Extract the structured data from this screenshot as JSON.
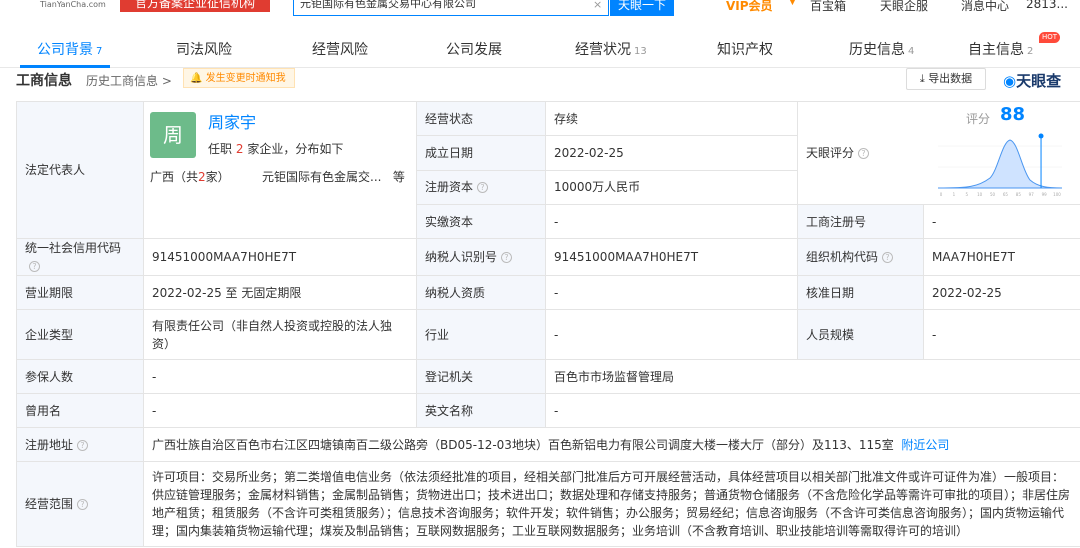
{
  "topbar": {
    "logo_text": "TianYanCha.com",
    "badge": "官方备案企业征信机构",
    "search_value": "元钜国际有色金属交易中心有限公司",
    "search_button": "天眼一下",
    "vip": "VIP会员",
    "links": [
      "百宝箱",
      "天眼企服",
      "消息中心",
      "2813..."
    ]
  },
  "tabs": [
    {
      "label": "公司背景",
      "count": "7"
    },
    {
      "label": "司法风险",
      "count": ""
    },
    {
      "label": "经营风险",
      "count": ""
    },
    {
      "label": "公司发展",
      "count": ""
    },
    {
      "label": "经营状况",
      "count": "13"
    },
    {
      "label": "知识产权",
      "count": ""
    },
    {
      "label": "历史信息",
      "count": "4"
    },
    {
      "label": "自主信息",
      "count": "2"
    }
  ],
  "hot_badge": "HOT",
  "section": {
    "title": "工商信息",
    "history_link": "历史工商信息 >",
    "notice": "发生变更时通知我",
    "export": "导出数据",
    "brand": "天眼查"
  },
  "legal_rep": {
    "label": "法定代表人",
    "avatar_char": "周",
    "name": "周家宇",
    "job_prefix": "任职",
    "job_count": "2",
    "job_suffix": "家企业，分布如下",
    "region_prefix": "广西（共",
    "region_count": "2",
    "region_suffix": "家）",
    "company": "元钜国际有色金属交...",
    "etc": "等"
  },
  "rows": {
    "status_label": "经营状态",
    "status": "存续",
    "founded_label": "成立日期",
    "founded": "2022-02-25",
    "capital_label": "注册资本",
    "capital": "10000万人民币",
    "paidin_label": "实缴资本",
    "paidin": "-",
    "score_label": "天眼评分",
    "regno_label": "工商注册号",
    "regno": "-",
    "credit_label": "统一社会信用代码",
    "credit": "91451000MAA7H0HE7T",
    "taxid_label": "纳税人识别号",
    "taxid": "91451000MAA7H0HE7T",
    "orgcode_label": "组织机构代码",
    "orgcode": "MAA7H0HE7T",
    "term_label": "营业期限",
    "term": "2022-02-25  至  无固定期限",
    "taxq_label": "纳税人资质",
    "taxq": "-",
    "approve_label": "核准日期",
    "approve": "2022-02-25",
    "type_label": "企业类型",
    "type": "有限责任公司（非自然人投资或控股的法人独资）",
    "industry_label": "行业",
    "industry": "-",
    "staff_label": "人员规模",
    "staff": "-",
    "insured_label": "参保人数",
    "insured": "-",
    "authority_label": "登记机关",
    "authority": "百色市市场监督管理局",
    "former_label": "曾用名",
    "former": "-",
    "english_label": "英文名称",
    "english": "-",
    "address_label": "注册地址",
    "address": "广西壮族自治区百色市右江区四塘镇南百二级公路旁（BD05-12-03地块）百色新铝电力有限公司调度大楼一楼大厅（部分）及113、115室",
    "nearby": "附近公司",
    "scope_label": "经营范围",
    "scope": "许可项目：交易所业务；第二类增值电信业务（依法须经批准的项目，经相关部门批准后方可开展经营活动，具体经营项目以相关部门批准文件或许可证件为准）一般项目：供应链管理服务；金属材料销售；金属制品销售；货物进出口；技术进出口；数据处理和存储支持服务；普通货物仓储服务（不含危险化学品等需许可审批的项目）；非居住房地产租赁；租赁服务（不含许可类租赁服务）；信息技术咨询服务；软件开发；软件销售；办公服务；贸易经纪；信息咨询服务（不含许可类信息咨询服务）；国内货物运输代理；国内集装箱货物运输代理；煤炭及制品销售；互联网数据服务；工业互联网数据服务；业务培训（不含教育培训、职业技能培训等需取得许可的培训）"
  },
  "score": {
    "label": "评分",
    "value": "88",
    "fraction": 0.88,
    "axis_ticks": [
      "0",
      "1",
      "5",
      "10",
      "50",
      "65",
      "85",
      "97",
      "99",
      "100"
    ]
  },
  "colors": {
    "accent": "#0084ff",
    "label_bg": "#f4f7fc",
    "badge_red": "#e03c31",
    "vip": "#ff8a00"
  }
}
